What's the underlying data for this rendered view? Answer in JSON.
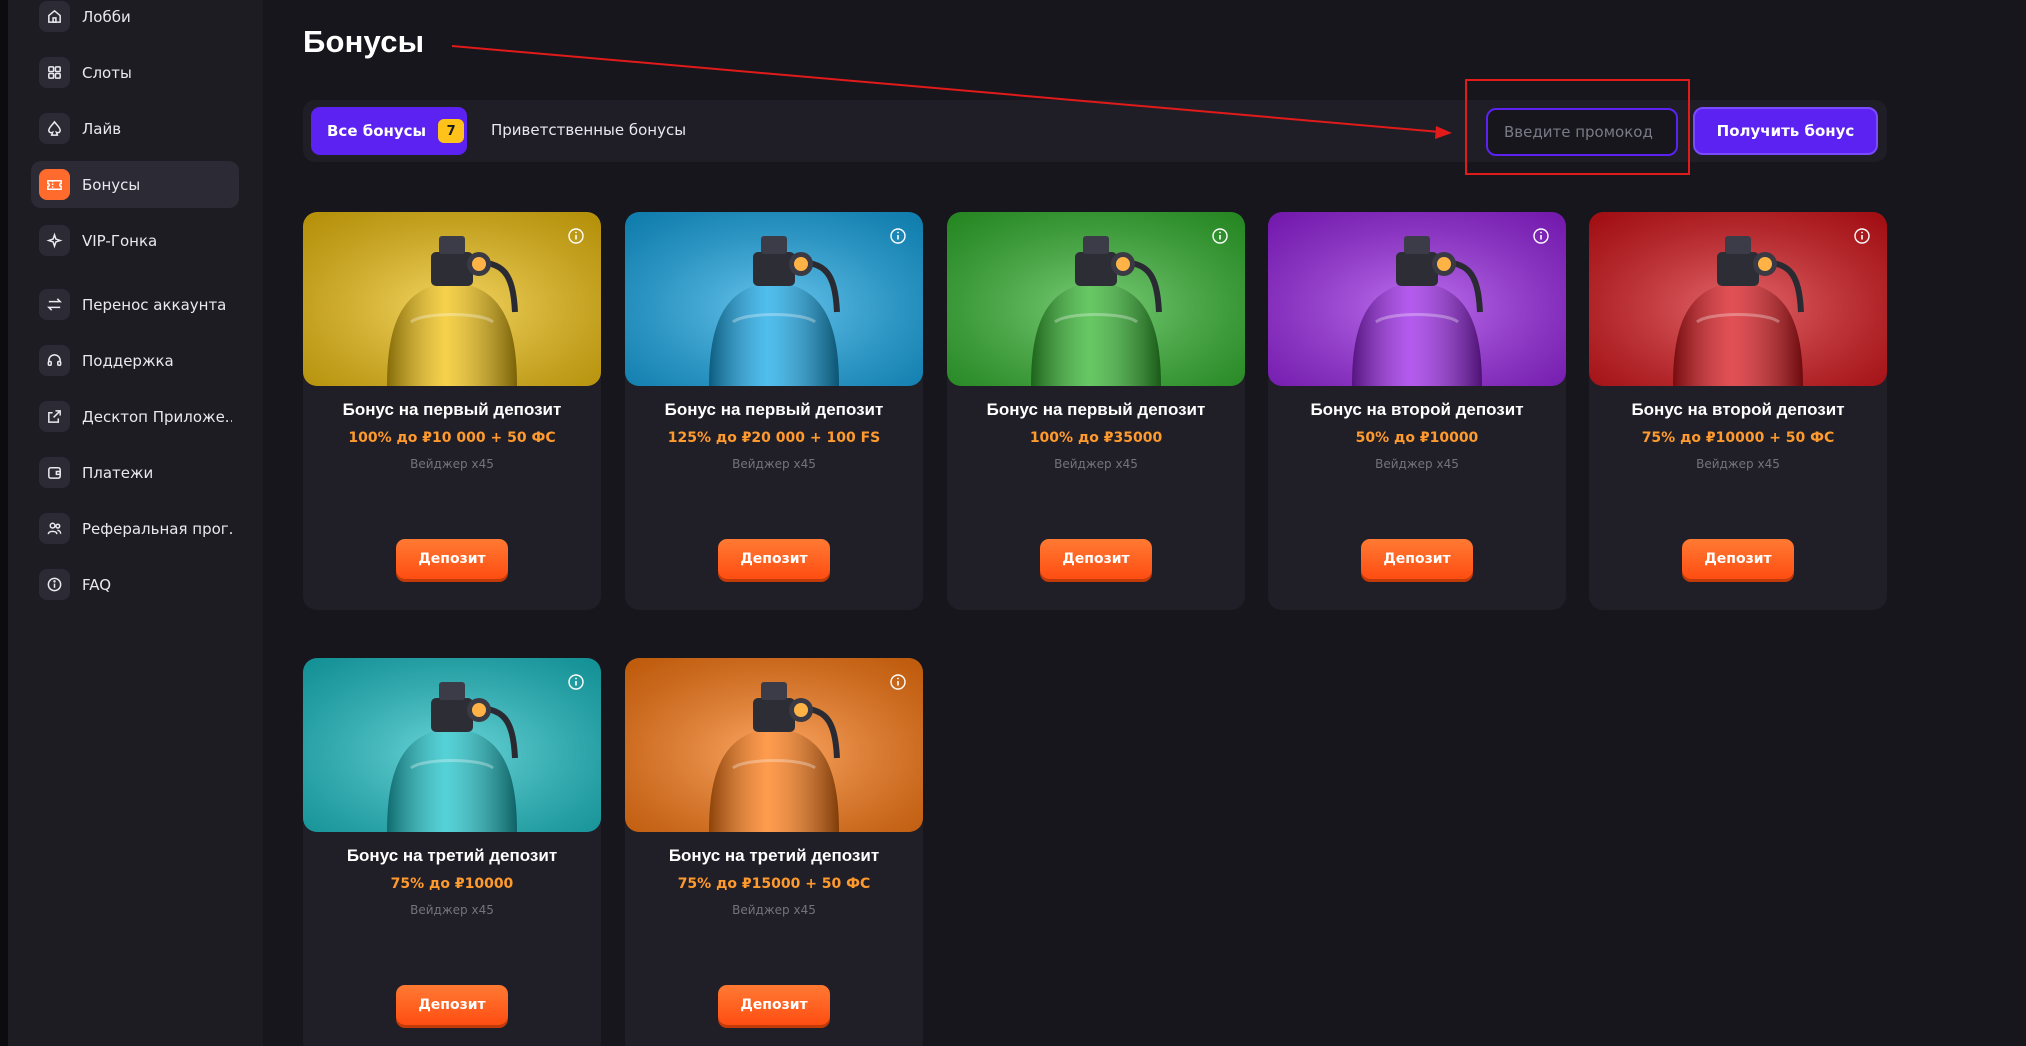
{
  "sidebar": {
    "items": [
      {
        "label": "Лобби",
        "icon": "home-icon"
      },
      {
        "label": "Слоты",
        "icon": "grid-icon"
      },
      {
        "label": "Лайв",
        "icon": "spade-icon"
      },
      {
        "label": "Бонусы",
        "icon": "ticket-icon",
        "active": true
      },
      {
        "label": "VIP-Гонка",
        "icon": "sparkle-icon"
      },
      {
        "label": "Перенос аккаунта",
        "icon": "transfer-icon"
      },
      {
        "label": "Поддержка",
        "icon": "headset-icon"
      },
      {
        "label": "Десктоп Приложе...",
        "icon": "external-link-icon"
      },
      {
        "label": "Платежи",
        "icon": "wallet-icon"
      },
      {
        "label": "Реферальная прог...",
        "icon": "users-icon"
      },
      {
        "label": "FAQ",
        "icon": "info-icon"
      }
    ]
  },
  "header": {
    "title": "Бонусы"
  },
  "filters": {
    "all_label": "Все бонусы",
    "all_count": "7",
    "welcome_label": "Приветственные бонусы",
    "promo_placeholder": "Введите промокод",
    "get_bonus_label": "Получить бонус"
  },
  "cards": [
    {
      "title": "Бонус на первый депозит",
      "offer": "100% до ₽10 000 + 50 ФС",
      "wager": "Вейджер x45",
      "button": "Депозит",
      "color": "#f2c20f"
    },
    {
      "title": "Бонус на первый депозит",
      "offer": "125% до ₽20 000 + 100 FS",
      "wager": "Вейджер x45",
      "button": "Депозит",
      "color": "#16a8e8"
    },
    {
      "title": "Бонус на первый депозит",
      "offer": "100% до ₽35000",
      "wager": "Вейджер x45",
      "button": "Депозит",
      "color": "#33b52f"
    },
    {
      "title": "Бонус на второй депозит",
      "offer": "50% до ₽10000",
      "wager": "Вейджер x45",
      "button": "Депозит",
      "color": "#9b24e8"
    },
    {
      "title": "Бонус на второй депозит",
      "offer": "75% до ₽10000 + 50 ФС",
      "wager": "Вейджер x45",
      "button": "Депозит",
      "color": "#d8151b"
    },
    {
      "title": "Бонус на третий депозит",
      "offer": "75% до ₽10000",
      "wager": "Вейджер x45",
      "button": "Депозит",
      "color": "#1cc3c9"
    },
    {
      "title": "Бонус на третий депозит",
      "offer": "75% до ₽15000 + 50 ФС",
      "wager": "Вейджер x45",
      "button": "Депозит",
      "color": "#ff7a12"
    }
  ],
  "colors": {
    "accent": "#5b22f2",
    "orange": "#ff5a1a",
    "annotation": "#e11a1a"
  }
}
